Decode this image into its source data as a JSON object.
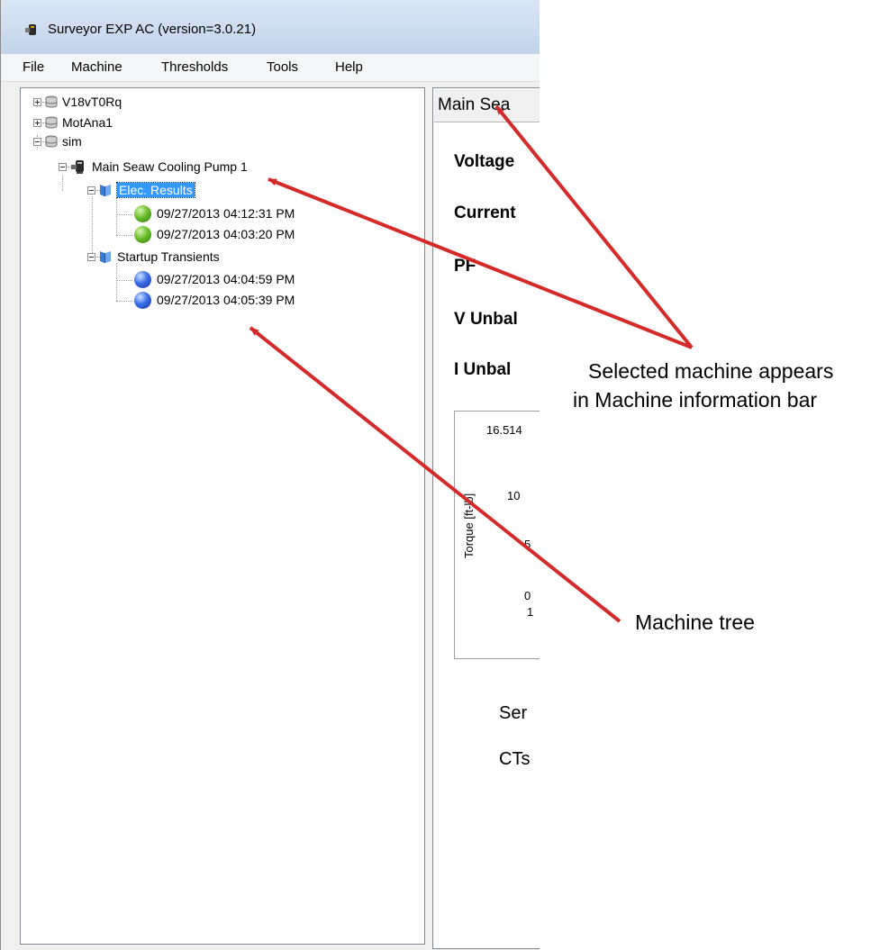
{
  "window": {
    "title": "Surveyor EXP AC (version=3.0.21)"
  },
  "menu": {
    "items": [
      "File",
      "Machine",
      "Thresholds",
      "Tools",
      "Help"
    ]
  },
  "tree": {
    "nodes": [
      {
        "label": "V18vT0Rq",
        "type": "database",
        "expanded": false
      },
      {
        "label": "MotAna1",
        "type": "database",
        "expanded": false
      },
      {
        "label": "sim",
        "type": "database",
        "expanded": true
      },
      {
        "label": "Main Seaw Cooling Pump 1",
        "type": "machine",
        "expanded": true
      },
      {
        "label": "Elec. Results",
        "type": "folder",
        "expanded": true,
        "selected": true
      },
      {
        "label": "09/27/2013 04:12:31 PM",
        "type": "result",
        "status_color": "#4caf22"
      },
      {
        "label": "09/27/2013 04:03:20 PM",
        "type": "result",
        "status_color": "#4caf22"
      },
      {
        "label": "Startup Transients",
        "type": "folder",
        "expanded": true
      },
      {
        "label": "09/27/2013 04:04:59 PM",
        "type": "result",
        "status_color": "#2f5ee0"
      },
      {
        "label": "09/27/2013 04:05:39 PM",
        "type": "result",
        "status_color": "#2f5ee0"
      }
    ]
  },
  "info_bar": {
    "text": "Main Sea"
  },
  "parameters": {
    "labels": [
      "Voltage",
      "Current",
      "PF",
      "V Unbal",
      "I Unbal"
    ]
  },
  "chart": {
    "ylabel": "Torque [ft-lb]",
    "yticks": [
      "16.514",
      "10",
      "5",
      "0"
    ],
    "xtick": "1"
  },
  "bottom_labels": [
    "Ser",
    "CTs"
  ],
  "annotations": {
    "info_bar_callout_line1": "Selected machine appears",
    "info_bar_callout_line2": "in Machine information bar",
    "tree_callout": "Machine tree",
    "arrow_color": "#d42a2a"
  }
}
